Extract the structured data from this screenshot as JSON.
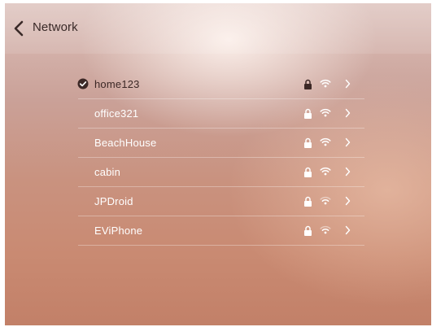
{
  "header": {
    "title": "Network"
  },
  "networks": [
    {
      "name": "home123",
      "connected": true,
      "secured": true,
      "signal": "strong"
    },
    {
      "name": "office321",
      "connected": false,
      "secured": true,
      "signal": "strong"
    },
    {
      "name": "BeachHouse",
      "connected": false,
      "secured": true,
      "signal": "strong"
    },
    {
      "name": "cabin",
      "connected": false,
      "secured": true,
      "signal": "strong"
    },
    {
      "name": "JPDroid",
      "connected": false,
      "secured": true,
      "signal": "medium"
    },
    {
      "name": "EViPhone",
      "connected": false,
      "secured": true,
      "signal": "medium"
    }
  ],
  "icons": {
    "back": "chevron-left-icon",
    "connected": "checkmark-circle-icon",
    "lock": "lock-icon",
    "wifi": "wifi-icon",
    "chevron": "chevron-right-icon"
  }
}
